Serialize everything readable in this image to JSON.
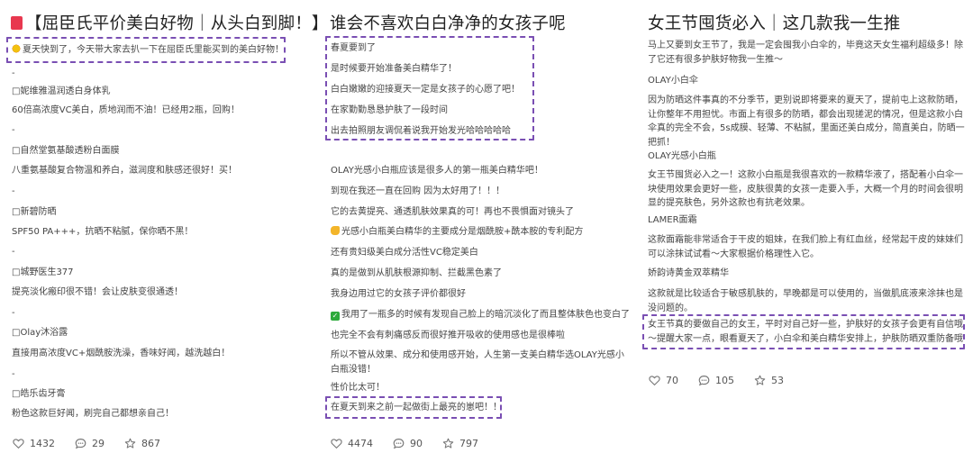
{
  "posts": [
    {
      "title": "【屈臣氏平价美白好物｜从头白到脚！】",
      "lines": [
        "夏天快到了，今天带大家去扒一下在屈臣氏里能买到的美白好物！",
        "-",
        "□妮维雅温润透白身体乳",
        "60倍高浓度VC美白，质地润而不油！已经用2瓶，回购！",
        "-",
        "□自然堂氨基酸透粉白面膜",
        "八重氨基酸复合物温和养白，滋润度和肤感还很好！买！",
        "-",
        "□新碧防晒",
        "SPF50 PA+++，抗晒不粘腻，保你晒不黑！",
        "-",
        "□城野医生377",
        "提亮淡化瘢印很不错！会让皮肤变很通透！",
        "-",
        "□Olay沐浴露",
        "直接用高浓度VC+烟酰胺洗澡，香味好闻，越洗越白！",
        "-",
        "□皓乐齿牙膏",
        "粉色这款巨好闻，刷完自己都想亲自己！"
      ],
      "stats": {
        "likes": "1432",
        "comments": "29",
        "favorites": "867"
      }
    },
    {
      "title": "谁会不喜欢白白净净的女孩子呢",
      "lines": [
        "春夏要到了",
        "是时候要开始准备美白精华了！",
        "白白嫩嫩的迎接夏天一定是女孩子的心愿了吧！",
        "在家勤勤恳恳护肤了一段时间",
        "出去拍照朋友调侃着说我开始发光哈哈哈哈哈",
        "",
        "OLAY光感小白瓶应该是很多人的第一瓶美白精华吧！",
        "到现在我还一直在回购 因为太好用了！！！",
        "它的去黄提亮、通透肌肤效果真的可！再也不畏惧面对镜头了",
        "光感小白瓶美白精华的主要成分是烟酰胺+酰本胺的专利配方",
        "还有贵妇级美白成分活性VC稳定美白",
        "真的是做到从肌肤根源抑制、拦截黑色素了",
        "我身边用过它的女孩子评价都很好",
        "我用了一瓶多的时候有发现自己脸上的暗沉淡化了而且整体肤色也变白了",
        "也完全不会有刺痛感反而很好推开吸收的使用感也是很棒啦",
        "所以不管从效果、成分和使用感开始，人生第一支美白精华选OLAY光感小白瓶没错！",
        "性价比太可！",
        "在夏天到来之前一起做街上最亮的崽吧！！"
      ],
      "stats": {
        "likes": "4474",
        "comments": "90",
        "favorites": "797"
      }
    },
    {
      "title": "女王节囤货必入｜这几款我一生推",
      "paras": [
        "马上又要到女王节了，我是一定会囤我小白伞的，毕竟这天女生福利超级多！除了它还有很多护肤好物我一生推～",
        "OLAY小白伞",
        "因为防晒这件事真的不分季节，更别说即将要来的夏天了，提前屯上这款防晒，让你整年不用担忧。市面上有很多的防晒，都会出现搓泥的情况，但是这款小白伞真的完全不会，5s成膜、轻薄、不粘腻，里面还美白成分，简直美白，防晒一把抓！",
        "OLAY光感小白瓶",
        "女王节囤货必入之一！这款小白瓶是我很喜欢的一款精华液了，搭配着小白伞一块使用效果会更好一些，皮肤很黄的女孩一走要入手，大概一个月的时间会很明显的提亮肤色，另外这款也有抗老效果。",
        "LAMER面霜",
        "这款面霜能非常适合于干皮的姐妹，在我们脸上有红血丝，经常起干皮的妹妹们可以涂抹试试看～大家根据价格理性入它。",
        "娇韵诗黄金双萃精华",
        "这款就是比较适合于敏感肌肤的，早晚都是可以使用的，当做肌底液来涂抹也是没问题的。",
        "女王节真的要做自己的女王，平时对自己好一些，护肤好的女孩子会更有自信哦～提醒大家一点，眼看夏天了，小白伞和美白精华安排上，护肤防晒双重防备哦"
      ],
      "stats": {
        "likes": "70",
        "comments": "105",
        "favorites": "53"
      }
    }
  ],
  "icons": {
    "like": "heart-outline-icon",
    "comment": "chat-bubble-icon",
    "favorite": "star-outline-icon",
    "sun": "sun-emoji-icon",
    "hand": "pointing-hand-emoji-icon",
    "check": "check-mark-emoji-icon"
  },
  "colors": {
    "highlight_border": "#7a4fb3",
    "title_mark": "#e8384f"
  }
}
